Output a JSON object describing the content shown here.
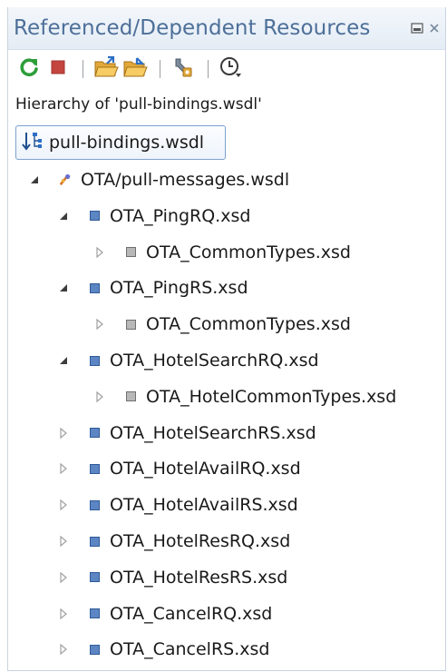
{
  "header": {
    "title": "Referenced/Dependent Resources"
  },
  "toolbar": {
    "buttons": [
      {
        "name": "refresh",
        "icon": "refresh-icon"
      },
      {
        "name": "stop",
        "icon": "stop-icon"
      },
      {
        "name": "dependent-hierarchy",
        "icon": "folder-open-icon"
      },
      {
        "name": "referenced-hierarchy",
        "icon": "folder-open-alt-icon"
      },
      {
        "name": "configure",
        "icon": "configure-icon"
      },
      {
        "name": "history",
        "icon": "history-icon"
      }
    ]
  },
  "hierarchy_label": "Hierarchy of 'pull-bindings.wsdl'",
  "root": {
    "label": "pull-bindings.wsdl"
  },
  "tree": [
    {
      "level": 0,
      "state": "expanded",
      "kind": "wsdl",
      "label": "OTA/pull-messages.wsdl"
    },
    {
      "level": 1,
      "state": "expanded",
      "kind": "xsd",
      "label": "OTA_PingRQ.xsd"
    },
    {
      "level": 2,
      "state": "collapsed",
      "kind": "xsd-ref",
      "label": "OTA_CommonTypes.xsd"
    },
    {
      "level": 1,
      "state": "expanded",
      "kind": "xsd",
      "label": "OTA_PingRS.xsd"
    },
    {
      "level": 2,
      "state": "collapsed",
      "kind": "xsd-ref",
      "label": "OTA_CommonTypes.xsd"
    },
    {
      "level": 1,
      "state": "expanded",
      "kind": "xsd",
      "label": "OTA_HotelSearchRQ.xsd"
    },
    {
      "level": 2,
      "state": "collapsed",
      "kind": "xsd-ref",
      "label": "OTA_HotelCommonTypes.xsd"
    },
    {
      "level": 1,
      "state": "collapsed",
      "kind": "xsd",
      "label": "OTA_HotelSearchRS.xsd"
    },
    {
      "level": 1,
      "state": "collapsed",
      "kind": "xsd",
      "label": "OTA_HotelAvailRQ.xsd"
    },
    {
      "level": 1,
      "state": "collapsed",
      "kind": "xsd",
      "label": "OTA_HotelAvailRS.xsd"
    },
    {
      "level": 1,
      "state": "collapsed",
      "kind": "xsd",
      "label": "OTA_HotelResRQ.xsd"
    },
    {
      "level": 1,
      "state": "collapsed",
      "kind": "xsd",
      "label": "OTA_HotelResRS.xsd"
    },
    {
      "level": 1,
      "state": "collapsed",
      "kind": "xsd",
      "label": "OTA_CancelRQ.xsd"
    },
    {
      "level": 1,
      "state": "collapsed",
      "kind": "xsd",
      "label": "OTA_CancelRS.xsd"
    }
  ],
  "colors": {
    "title": "#4d6f99",
    "refresh": "#2e9e3a",
    "stop": "#c4453f",
    "xsd_node": "#5b86c3",
    "xsd_ref_node": "#b8b8b8"
  }
}
